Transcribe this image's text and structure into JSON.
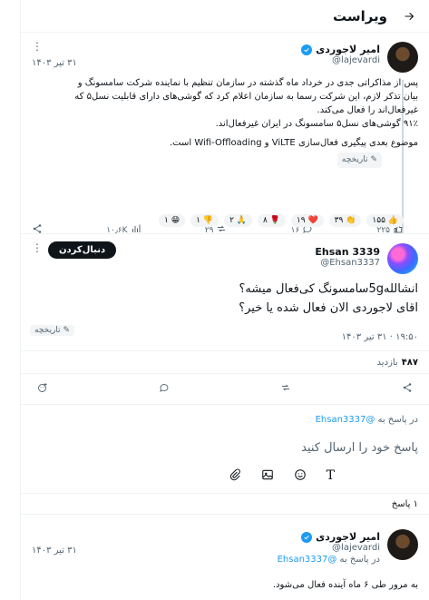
{
  "header": {
    "title": "ویراست"
  },
  "post1": {
    "name": "امیر لاجوردی",
    "handle": "@lajevardi",
    "date": "۳۱ تیر ۱۴۰۳",
    "lines": [
      "پس از مذاکراتی جدی در خرداد ماه گذشته در سازمان تنظیم با نماینده شرکت سامسونگ و",
      "بیان تذکر لازم، این شرکت رسما به سازمان اعلام کرد که گوشی‌های دارای قابلیت نسل۵ که",
      "غیر‌فعال‌اند را فعال می‌کند.",
      "۹۱٪ گوشی‌های نسل۵ سامسونگ در ایران غیر‌فعال‌اند."
    ],
    "line2": "موضوع بعدی پیگیری فعال‌سازی ViLTE و Wifi-Offloading است.",
    "history": "تاریخچه",
    "stats": {
      "likes": "۲۲۵",
      "replies": "۱۶",
      "reposts": "۲۹",
      "views": "۱۰٫۶K"
    },
    "reactions": [
      "👍 ۱۵۵",
      "👏 ۳۹",
      "❤️ ۱۹",
      "🌹 ۸",
      "🙏 ۲",
      "👎 ۱",
      "😁 ۱"
    ]
  },
  "post2": {
    "name": "Ehsan 3339",
    "handle": "@Ehsan3337",
    "follow_label": "دنبال‌کردن",
    "text1": "انشالله5gسامسونگ کی‌فعال میشه؟",
    "text2": "اقای لاجوردی الان فعال شده یا خیر؟",
    "history": "تاریخچه",
    "timestamp": "۱۹:۵۰ · ۳۱ تیر ۱۴۰۳",
    "views_count": "۴۸۷",
    "views_label": "بازدید"
  },
  "reply_box": {
    "reply_to_prefix": "در پاسخ به",
    "reply_to_handle": "@Ehsan3337",
    "placeholder": "پاسخ خود را ارسال کنید"
  },
  "replies_count": "۱ پاسخ",
  "post3": {
    "name": "امیر لاجوردی",
    "handle": "@lajevardi",
    "date": "۳۱ تیر ۱۴۰۳",
    "reply_prefix": "در پاسخ به",
    "reply_handle": "@Ehsan3337",
    "text": "به مرور طی ۶ ماه آینده فعال می‌شود."
  }
}
